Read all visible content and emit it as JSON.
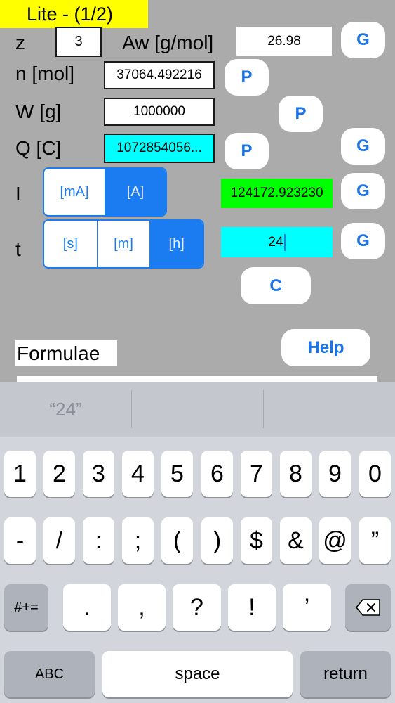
{
  "header": {
    "title": "Lite - (1/2)"
  },
  "form": {
    "z": {
      "label": "z",
      "value": "3"
    },
    "aw": {
      "label": "Aw [g/mol]",
      "value": "26.98",
      "button": "G"
    },
    "n": {
      "label": "n  [mol]",
      "value": "37064.492216",
      "button": "P"
    },
    "w": {
      "label": "W [g]",
      "value": "1000000",
      "button": "P"
    },
    "q": {
      "label": "Q [C]",
      "value": "1072854056...",
      "button_p": "P",
      "button_g": "G"
    },
    "i": {
      "label": "I",
      "units": [
        "[mA]",
        "[A]"
      ],
      "selected": "[A]",
      "value": "124172.923230",
      "button": "G"
    },
    "t": {
      "label": "t",
      "units": [
        "[s]",
        "[m]",
        "[h]"
      ],
      "selected": "[h]",
      "value": "24",
      "button": "G"
    },
    "clear_button": "C",
    "help_button": "Help",
    "formulae_label": "Formulae"
  },
  "keyboard": {
    "suggestions": [
      "“24”",
      "",
      ""
    ],
    "row1": [
      "1",
      "2",
      "3",
      "4",
      "5",
      "6",
      "7",
      "8",
      "9",
      "0"
    ],
    "row2": [
      "-",
      "/",
      ":",
      ";",
      "(",
      ")",
      "$",
      "&",
      "@",
      "”"
    ],
    "row3": [
      ".",
      ",",
      "?",
      "!",
      "’"
    ],
    "symbols_key": "#+=",
    "abc_key": "ABC",
    "space_key": "space",
    "return_key": "return"
  },
  "colors": {
    "accent": "#1a73e8",
    "cyan": "#00ffff",
    "green": "#00ff00",
    "title_bg": "#ffff00"
  }
}
